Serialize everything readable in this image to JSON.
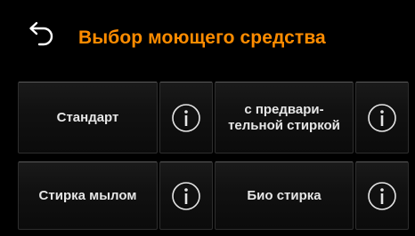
{
  "header": {
    "back_icon": "back-arrow-icon",
    "title": "Выбор моющего средства"
  },
  "programs": [
    {
      "label": "Стандарт",
      "info_icon": "info-icon"
    },
    {
      "label": "с предвари-\nтельной стиркой",
      "info_icon": "info-icon"
    },
    {
      "label": "Стирка мылом",
      "info_icon": "info-icon"
    },
    {
      "label": "Био стирка",
      "info_icon": "info-icon"
    }
  ],
  "colors": {
    "accent": "#ff8c00",
    "background": "#000000",
    "text": "#e6e6e6"
  }
}
